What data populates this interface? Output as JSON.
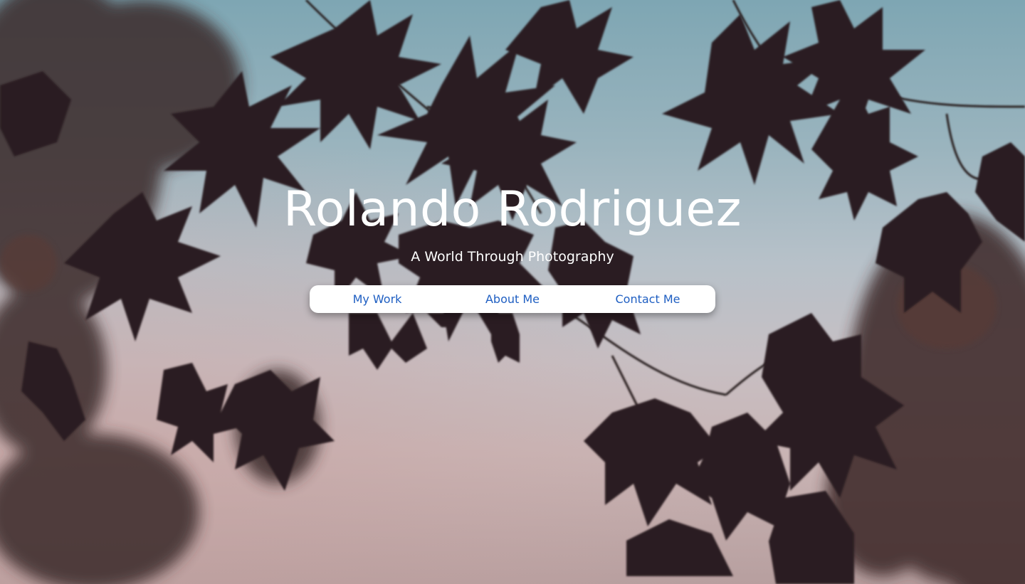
{
  "hero": {
    "title": "Rolando Rodriguez",
    "subtitle": "A World Through Photography",
    "background_image": "leaf-silhouette-sky"
  },
  "nav": {
    "items": [
      {
        "label": "My Work"
      },
      {
        "label": "About Me"
      },
      {
        "label": "Contact Me"
      }
    ]
  },
  "colors": {
    "sky_top": "#7ea6b3",
    "sky_bottom": "#c9b4b4",
    "leaf": "#2a1f21",
    "leaf_warm": "#4a2c2a",
    "title_text": "#ffffff",
    "nav_background": "#ffffff",
    "nav_link": "#1f5fc2"
  }
}
